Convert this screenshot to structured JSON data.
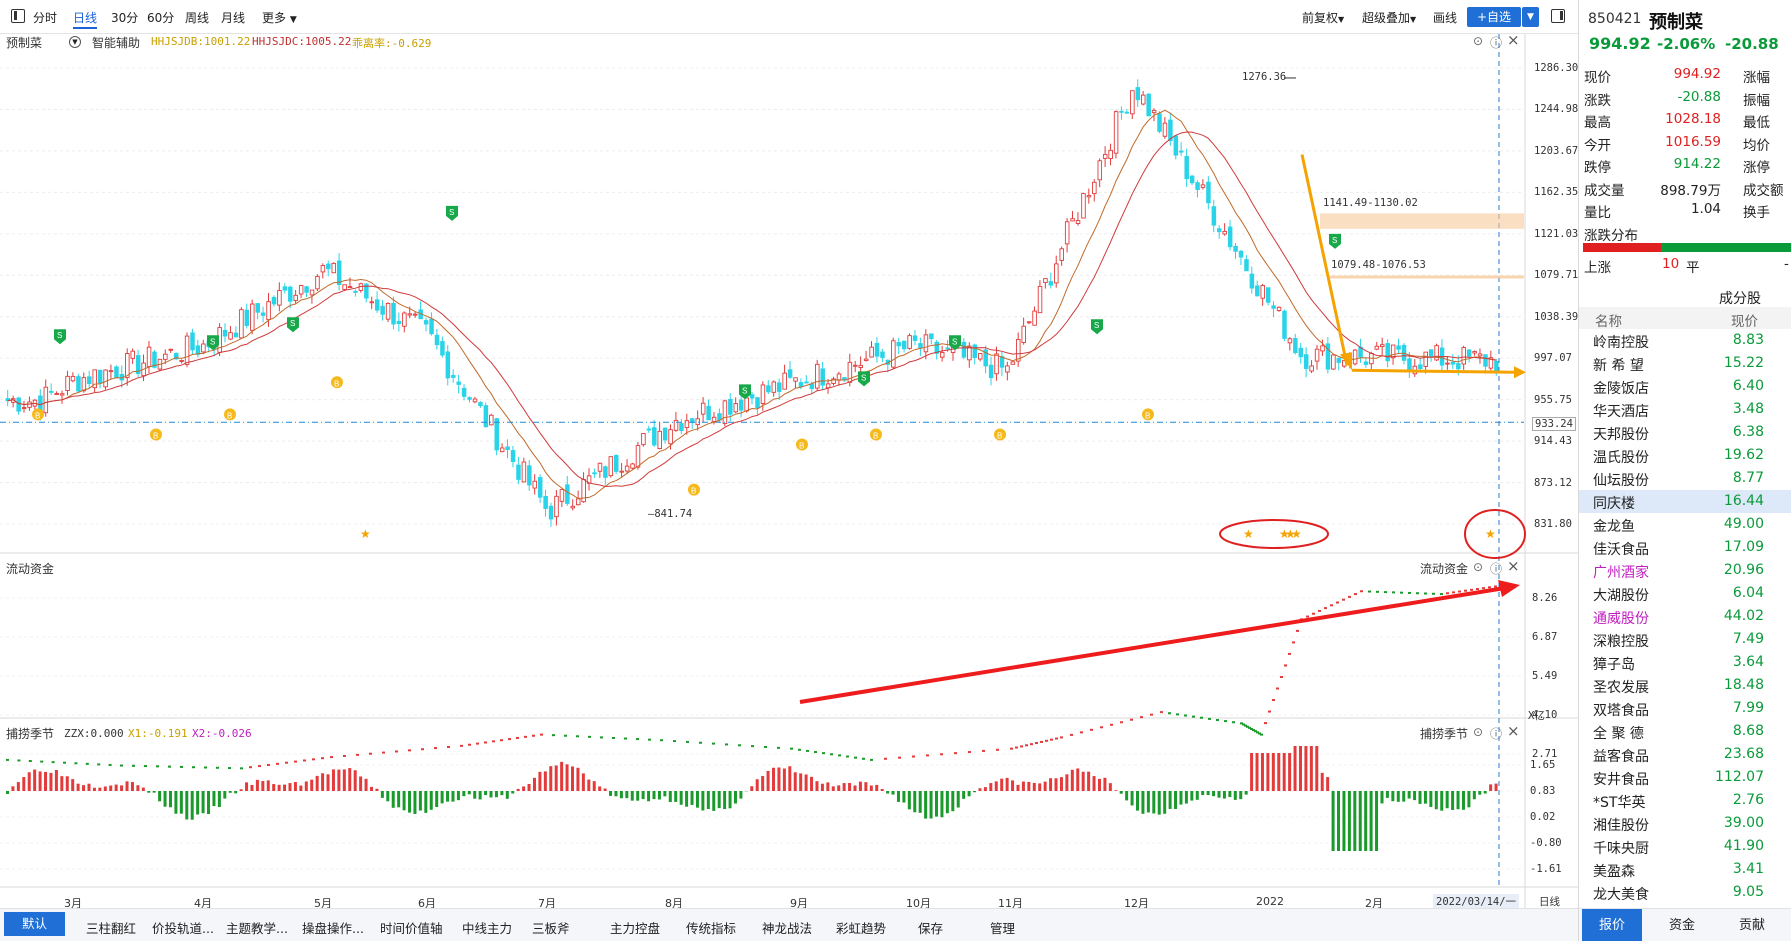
{
  "toolbar": {
    "tabs": [
      "分时",
      "日线",
      "30分",
      "60分",
      "周线",
      "月线",
      "更多"
    ],
    "active_tab": "日线",
    "right": {
      "fq": "前复权",
      "overlay": "超级叠加",
      "draw": "画线",
      "add": "+自选"
    }
  },
  "main_panel": {
    "name": "预制菜",
    "assist": "智能辅助",
    "legend": [
      {
        "text": "HHJSJDB:1001.22",
        "color": "#c8a000"
      },
      {
        "text": "HHJSJDC:1005.22",
        "color": "#c03030"
      },
      {
        "text": "乖离率:-0.629",
        "color": "#c8a000"
      }
    ],
    "y_ticks": [
      "1286.30",
      "1244.98",
      "1203.67",
      "1162.35",
      "1121.03",
      "1079.71",
      "1038.39",
      "997.07",
      "955.75",
      "914.43",
      "873.12",
      "831.80"
    ],
    "cur_price_label": "933.24",
    "annotations": {
      "high": "1276.36",
      "low": "841.74",
      "zone1": "1141.49-1130.02",
      "zone2": "1079.48-1076.53"
    },
    "signals": {
      "buy": "B",
      "sell": "S",
      "star": "★"
    }
  },
  "flow_panel": {
    "title": "流动资金",
    "right_title": "流动资金",
    "y_ticks": [
      "8.26",
      "6.87",
      "5.49",
      "4.10",
      "2.71"
    ],
    "unit": "X亿"
  },
  "season_panel": {
    "title": "捕捞季节",
    "legend": [
      {
        "text": "ZZX:0.000",
        "color": "#333333"
      },
      {
        "text": "X1:-0.191",
        "color": "#c8a000"
      },
      {
        "text": "X2:-0.026",
        "color": "#c020c0"
      }
    ],
    "right_title": "捕捞季节",
    "y_ticks": [
      "1.65",
      "0.83",
      "0.02",
      "-0.80",
      "-1.61"
    ]
  },
  "x_axis": {
    "months": [
      "3月",
      "4月",
      "5月",
      "6月",
      "7月",
      "8月",
      "9月",
      "10月",
      "11月",
      "12月",
      "2022",
      "2月"
    ],
    "cursor_date": "2022/03/14/一",
    "period": "日线"
  },
  "bottom_tabs": [
    "默认",
    "三柱翻红",
    "价投轨道...",
    "主题教学...",
    "操盘操作...",
    "时间价值轴",
    "中线主力",
    "三板斧",
    "主力控盘",
    "传统指标",
    "神龙战法",
    "彩虹趋势",
    "保存",
    "管理"
  ],
  "sidebar": {
    "code": "850421",
    "name": "预制菜",
    "price": "994.92",
    "change_pct": "-2.06%",
    "change": "-20.88",
    "rows": [
      {
        "l1": "现价",
        "v1": "994.92",
        "c1": "red",
        "l2": "涨幅"
      },
      {
        "l1": "涨跌",
        "v1": "-20.88",
        "c1": "green",
        "l2": "振幅"
      },
      {
        "l1": "最高",
        "v1": "1028.18",
        "c1": "red",
        "l2": "最低"
      },
      {
        "l1": "今开",
        "v1": "1016.59",
        "c1": "red",
        "l2": "均价"
      },
      {
        "l1": "跌停",
        "v1": "914.22",
        "c1": "green",
        "l2": "涨停"
      },
      {
        "l1": "成交量",
        "v1": "898.79万",
        "c1": "",
        "l2": "成交额"
      },
      {
        "l1": "量比",
        "v1": "1.04",
        "c1": "",
        "l2": "换手"
      }
    ],
    "dist_title": "涨跌分布",
    "up_label": "上涨",
    "up_count": "10",
    "flat_label": "平",
    "flat_value": "-",
    "cons_title": "成分股",
    "cons_headers": [
      "名称",
      "现价"
    ],
    "constituents": [
      {
        "name": "岭南控股",
        "price": "8.83"
      },
      {
        "name": "新 希 望",
        "price": "15.22"
      },
      {
        "name": "金陵饭店",
        "price": "6.40"
      },
      {
        "name": "华天酒店",
        "price": "3.48"
      },
      {
        "name": "天邦股份",
        "price": "6.38"
      },
      {
        "name": "温氏股份",
        "price": "19.62"
      },
      {
        "name": "仙坛股份",
        "price": "8.77"
      },
      {
        "name": "同庆楼",
        "price": "16.44"
      },
      {
        "name": "金龙鱼",
        "price": "49.00"
      },
      {
        "name": "佳沃食品",
        "price": "17.09"
      },
      {
        "name": "广州酒家",
        "price": "20.96"
      },
      {
        "name": "大湖股份",
        "price": "6.04"
      },
      {
        "name": "通威股份",
        "price": "44.02"
      },
      {
        "name": "深粮控股",
        "price": "7.49"
      },
      {
        "name": "獐子岛",
        "price": "3.64"
      },
      {
        "name": "圣农发展",
        "price": "18.48"
      },
      {
        "name": "双塔食品",
        "price": "7.99"
      },
      {
        "name": "全 聚 德",
        "price": "8.68"
      },
      {
        "name": "益客食品",
        "price": "23.68"
      },
      {
        "name": "安井食品",
        "price": "112.07"
      },
      {
        "name": "*ST华英",
        "price": "2.76"
      },
      {
        "name": "湘佳股份",
        "price": "39.00"
      },
      {
        "name": "千味央厨",
        "price": "41.90"
      },
      {
        "name": "美盈森",
        "price": "3.41"
      },
      {
        "name": "龙大美食",
        "price": "9.05"
      }
    ],
    "bottom_tabs": [
      "报价",
      "资金",
      "贡献"
    ]
  },
  "colors": {
    "up": "#e33b3b",
    "down": "#2ad4e8",
    "accent": "#1f6fd6",
    "ma1": "#c06a2a",
    "ma2": "#d03a3a",
    "arrow_red": "#ee1c1c",
    "arrow_orange": "#f5a300",
    "macd_pos": "#e33b3b",
    "macd_neg": "#1a9a2a"
  },
  "chart_data": {
    "type": "candlestick",
    "title": "预制菜",
    "x_range": [
      "2021-02",
      "2022-03-14"
    ],
    "price_ylim": [
      831.8,
      1286.3
    ],
    "price_anchors": [
      {
        "x": "2021-03",
        "close": 955
      },
      {
        "x": "2021-04",
        "close": 975
      },
      {
        "x": "2021-05",
        "close": 1010
      },
      {
        "x": "2021-06",
        "close": 1085
      },
      {
        "x": "2021-07",
        "close": 1020
      },
      {
        "x": "2021-08",
        "close": 845
      },
      {
        "x": "2021-09",
        "close": 935
      },
      {
        "x": "2021-10",
        "close": 975
      },
      {
        "x": "2021-11",
        "close": 1010
      },
      {
        "x": "2021-12",
        "close": 985
      },
      {
        "x": "2022-01",
        "close": 1270
      },
      {
        "x": "2022-02",
        "close": 1000
      },
      {
        "x": "2022-03-14",
        "close": 994.92
      }
    ],
    "series": [
      {
        "name": "流动资金",
        "unit": "亿",
        "ylim": [
          2.71,
          8.26
        ],
        "values": [
          2.5,
          2.3,
          2.2,
          2.6,
          3.0,
          3.4,
          3.2,
          2.9,
          2.5,
          2.9,
          3.3,
          4.2,
          3.8,
          3.4,
          7.5,
          8.5,
          8.4,
          8.7
        ]
      },
      {
        "name": "捕捞季节",
        "ylim": [
          -1.61,
          1.65
        ]
      }
    ]
  }
}
